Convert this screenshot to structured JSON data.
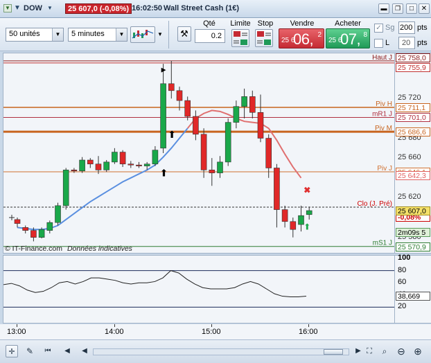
{
  "titlebar": {
    "symbol": "DOW",
    "price_badge": "25 607,0 (-0,08%)",
    "time": "16:02:50",
    "instrument": "Wall Street Cash (1€)",
    "badge_color": "#c9252c"
  },
  "toolbar": {
    "units_select": "50 unités",
    "interval_select": "5 minutes",
    "qty_label": "Qté",
    "qty_value": "0.2",
    "limit_label": "Limite",
    "stop_label": "Stop",
    "sell_label": "Vendre",
    "buy_label": "Acheter",
    "sell_price": {
      "small": "25 6",
      "big": "06,",
      "sup": "2"
    },
    "buy_price": {
      "small": "25 6",
      "big": "07,",
      "sup": "8"
    },
    "sg_label": "Sg",
    "sg_value": "200",
    "sg_unit": "pts",
    "l_label": "L",
    "l_value": "20",
    "l_unit": "pts"
  },
  "chart": {
    "watermark": "© IT-Finance.com",
    "watermark_note": "Données indicatives",
    "levels": [
      {
        "name": "Haut J",
        "value": "25 758,0",
        "color": "#8b1a1a"
      },
      {
        "name": "",
        "value": "25 755,9",
        "color": "#c03030"
      },
      {
        "name": "Piv H",
        "value": "25 711,1",
        "color": "#c8641e"
      },
      {
        "name": "mR1 J",
        "value": "25 701,0",
        "color": "#b03040"
      },
      {
        "name": "Piv M",
        "value": "25 686,6",
        "color": "#c8641e"
      },
      {
        "name": "Piv J",
        "value": "25 646,1",
        "color": "#d07030"
      },
      {
        "name": "",
        "value": "25 642,3",
        "color": "#e06060"
      },
      {
        "name": "Clo (J. Pré)",
        "value": "-0,08%",
        "color": "#cc0000"
      },
      {
        "name": "mS1 J",
        "value": "25 570,9",
        "color": "#2e7d32"
      }
    ],
    "current_price": "25 607,0",
    "countdown": "2m09s",
    "countdown_extra": "5",
    "y_ticks": [
      "25 720",
      "25 700",
      "25 680",
      "25 660",
      "25 620",
      "25 600",
      "25 580"
    ],
    "x_ticks": [
      "13:00",
      "14:00",
      "15:00",
      "16:00"
    ]
  },
  "chart_data": {
    "type": "candlestick",
    "title": "Wall Street Cash (1€)",
    "ylim": [
      25570,
      25760
    ],
    "candles": [
      {
        "o": 25598,
        "h": 25600,
        "l": 25590,
        "c": 25594
      },
      {
        "o": 25590,
        "h": 25592,
        "l": 25584,
        "c": 25587
      },
      {
        "o": 25587,
        "h": 25590,
        "l": 25576,
        "c": 25580
      },
      {
        "o": 25580,
        "h": 25590,
        "l": 25579,
        "c": 25588
      },
      {
        "o": 25587,
        "h": 25597,
        "l": 25584,
        "c": 25595
      },
      {
        "o": 25595,
        "h": 25615,
        "l": 25592,
        "c": 25612
      },
      {
        "o": 25612,
        "h": 25650,
        "l": 25608,
        "c": 25648
      },
      {
        "o": 25648,
        "h": 25650,
        "l": 25645,
        "c": 25647
      },
      {
        "o": 25647,
        "h": 25661,
        "l": 25645,
        "c": 25658
      },
      {
        "o": 25658,
        "h": 25660,
        "l": 25650,
        "c": 25654
      },
      {
        "o": 25654,
        "h": 25662,
        "l": 25644,
        "c": 25648
      },
      {
        "o": 25648,
        "h": 25658,
        "l": 25646,
        "c": 25656
      },
      {
        "o": 25656,
        "h": 25670,
        "l": 25654,
        "c": 25666
      },
      {
        "o": 25666,
        "h": 25668,
        "l": 25651,
        "c": 25654
      },
      {
        "o": 25654,
        "h": 25657,
        "l": 25650,
        "c": 25653
      },
      {
        "o": 25653,
        "h": 25656,
        "l": 25650,
        "c": 25652
      },
      {
        "o": 25652,
        "h": 25656,
        "l": 25648,
        "c": 25654
      },
      {
        "o": 25654,
        "h": 25672,
        "l": 25652,
        "c": 25668
      },
      {
        "o": 25670,
        "h": 25755,
        "l": 25665,
        "c": 25735
      },
      {
        "o": 25735,
        "h": 25758,
        "l": 25720,
        "c": 25728
      },
      {
        "o": 25728,
        "h": 25732,
        "l": 25708,
        "c": 25718
      },
      {
        "o": 25718,
        "h": 25722,
        "l": 25698,
        "c": 25702
      },
      {
        "o": 25702,
        "h": 25708,
        "l": 25678,
        "c": 25684
      },
      {
        "o": 25684,
        "h": 25690,
        "l": 25640,
        "c": 25648
      },
      {
        "o": 25648,
        "h": 25660,
        "l": 25632,
        "c": 25645
      },
      {
        "o": 25645,
        "h": 25662,
        "l": 25640,
        "c": 25656
      },
      {
        "o": 25656,
        "h": 25700,
        "l": 25652,
        "c": 25696
      },
      {
        "o": 25696,
        "h": 25718,
        "l": 25690,
        "c": 25712
      },
      {
        "o": 25712,
        "h": 25730,
        "l": 25700,
        "c": 25722
      },
      {
        "o": 25722,
        "h": 25728,
        "l": 25700,
        "c": 25706
      },
      {
        "o": 25706,
        "h": 25724,
        "l": 25676,
        "c": 25680
      },
      {
        "o": 25680,
        "h": 25684,
        "l": 25640,
        "c": 25650
      },
      {
        "o": 25650,
        "h": 25654,
        "l": 25590,
        "c": 25608
      },
      {
        "o": 25608,
        "h": 25612,
        "l": 25590,
        "c": 25596
      },
      {
        "o": 25596,
        "h": 25600,
        "l": 25580,
        "c": 25588
      },
      {
        "o": 25593,
        "h": 25612,
        "l": 25586,
        "c": 25602
      },
      {
        "o": 25603,
        "h": 25611,
        "l": 25598,
        "c": 25607
      }
    ],
    "moving_average": [
      25590,
      25589,
      25588,
      25588,
      25589,
      25592,
      25598,
      25604,
      25610,
      25616,
      25621,
      25626,
      25631,
      25636,
      25640,
      25644,
      25648,
      25653,
      25661,
      25670,
      25680,
      25690,
      25700,
      25705,
      25708,
      25707,
      25704,
      25700,
      25697,
      25696,
      25695,
      25690,
      25678,
      25664,
      25651,
      25640
    ],
    "oscillator": {
      "ylim": [
        0,
        100
      ],
      "y_ticks": [
        100,
        80,
        60,
        40,
        20
      ],
      "current": "38,669",
      "values": [
        57,
        59,
        55,
        48,
        44,
        46,
        52,
        60,
        62,
        58,
        62,
        68,
        68,
        66,
        64,
        60,
        58,
        60,
        60,
        62,
        68,
        80,
        76,
        66,
        58,
        52,
        50,
        50,
        50,
        52,
        58,
        62,
        58,
        50,
        42,
        38,
        37,
        37,
        38
      ]
    }
  }
}
